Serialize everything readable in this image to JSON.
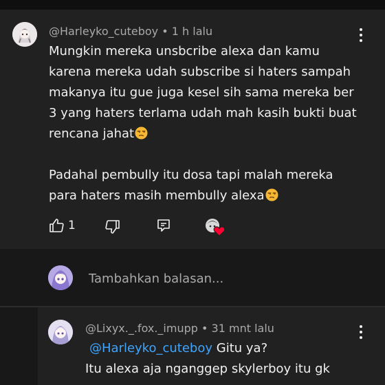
{
  "comment": {
    "author": "@Harleyko_cuteboy",
    "time": "1 h lalu",
    "paragraph1": "Mungkin mereka unsbcribe alexa dan kamu karena mereka udah subscribe si haters sampah makanya itu gue juga kesel sih sama mereka ber 3 yang haters terlama udah mah kasih bukti buat rencana jahat",
    "paragraph2": "Padahal pembully itu dosa tapi malah mereka para haters masih membully alexa",
    "emoji": "unamused-face",
    "like_count": "1"
  },
  "actions": {
    "like_icon": "thumb-up-icon",
    "dislike_icon": "thumb-down-icon",
    "reply_icon": "reply-icon",
    "creator_heart_icon": "creator-heart-icon"
  },
  "reply_box": {
    "placeholder": "Tambahkan balasan..."
  },
  "reply": {
    "author": "@Lixyx._.fox._imupp",
    "time": "31 mnt lalu",
    "mention": "@Harleyko_cuteboy",
    "text_after_mention": "Gitu ya?",
    "line2": "Itu alexa aja nganggep skylerboy itu gk"
  },
  "colors": {
    "background": "#181818",
    "card": "#212121",
    "text": "#f1f1f1",
    "secondary_text": "#aaaaaa",
    "link": "#3ea6ff",
    "heart": "#ff0033"
  }
}
